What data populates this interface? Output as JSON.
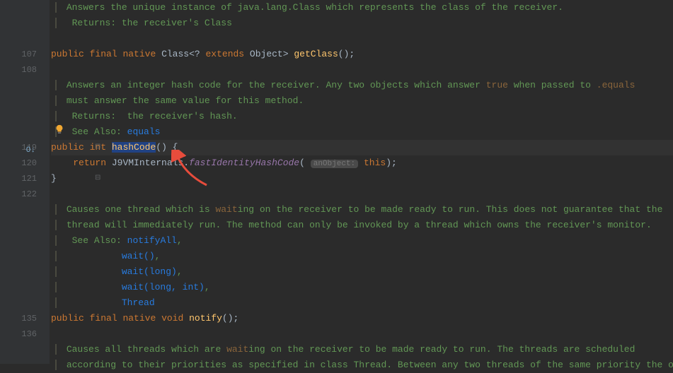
{
  "gutter": {
    "l107": "107",
    "l108": "108",
    "l119": "119",
    "l120": "120",
    "l121": "121",
    "l122": "122",
    "l135": "135",
    "l136": "136"
  },
  "doc1": {
    "line1": "Answers the unique instance of java.lang.Class which represents the class of the receiver.",
    "returnsLabel": "Returns:",
    "returnsVal": "the receiver's Class"
  },
  "code107": {
    "kw1": "public",
    "kw2": "final",
    "kw3": "native",
    "type": "Class",
    "q": "<? ",
    "kw4": "extends",
    "obj": "Object",
    "gt": "> ",
    "m": "getClass",
    "p": "();"
  },
  "doc2": {
    "line1a": "Answers an integer hash code for the receiver. Any two objects which answer ",
    "code1": "true",
    "line1b": " when passed to ",
    "code2": ".equals",
    "line2": "must answer the same value for this method.",
    "returnsLabel": "Returns:",
    "returnsVal": "the receiver's hash.",
    "seeAlsoLabel": "See Also:",
    "seeLink": "equals"
  },
  "code119": {
    "kw1": "public",
    "kw2": "int",
    "m": "hashCode",
    "p": "() {"
  },
  "code120": {
    "kw": "return",
    "cls": "J9VMInternals",
    "dot": ".",
    "m": "fastIdentityHashCode",
    "lp": "(",
    "hint": "anObject:",
    "th": "this",
    "rp": ");"
  },
  "code121": {
    "b": "}"
  },
  "doc3": {
    "l1a": "Causes one thread which is ",
    "code1": "wait",
    "l1b": "ing on the receiver to be made ready to run. This does not guarantee that the",
    "l2": "thread will immediately run. The method can only be invoked by a thread which owns the receiver's monitor.",
    "seeAlsoLabel": "See Also:",
    "s1": "notifyAll",
    "c1": ",",
    "s2": "wait()",
    "c2": ",",
    "s3": "wait(long)",
    "c3": ",",
    "s4": "wait(long, int)",
    "c4": ",",
    "s5": "Thread"
  },
  "code135": {
    "kw1": "public",
    "kw2": "final",
    "kw3": "native",
    "kw4": "void",
    "m": "notify",
    "p": "();"
  },
  "doc4": {
    "l1a": "Causes all threads which are ",
    "code1": "wait",
    "l1b": "ing on the receiver to be made ready to run. The threads are scheduled",
    "l2": "according to their priorities as specified in class Thread. Between any two threads of the same priority the one"
  }
}
